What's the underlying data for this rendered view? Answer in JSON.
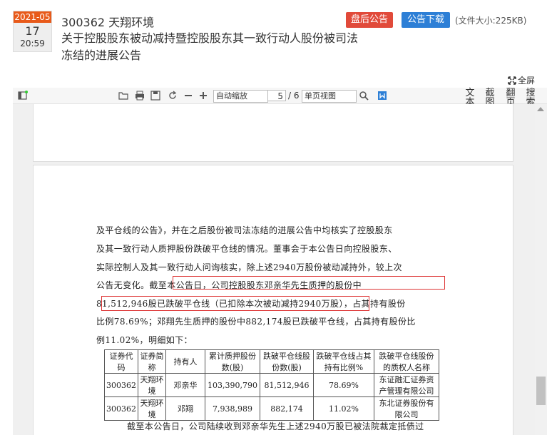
{
  "date": {
    "year_month": "2021-05",
    "day": "17",
    "time": "20:59"
  },
  "header": {
    "code_name": "300362 天翔环境",
    "title": "关于控股股东被动减持暨控股股东其一致行动人股份被司法冻结的进展公告",
    "btn_after": "盘后公告",
    "btn_download": "公告下载",
    "file_size": "(文件大小:225KB)",
    "fullscreen": "全屏"
  },
  "toolbar": {
    "zoom": "自动缩放",
    "page_current": "5",
    "page_total": "/ 6",
    "view_mode": "单页视图",
    "tools": [
      "文本",
      "截图",
      "翻页",
      "搜索"
    ]
  },
  "doc": {
    "lines": [
      "及平仓线的公告》，并在之后股份被司法冻结的进展公告中均核实了控股股东",
      "及其一致行动人质押股份跌破平仓线的情况。董事会于本公告日向控股股东、",
      "实际控制人及其一致行动人问询核实，除上述2940万股份被动减持外，较上次",
      "公告无变化。截至本公告日，公司控股股东邓亲华先生质押的股份中",
      "81,512,946股已跌破平仓线（已扣除本次被动减持2940万股），占其持有股份",
      "比例78.69%；邓翔先生质押的股份中882,174股已跌破平仓线，占其持有股份比",
      "例11.02%，明细如下："
    ],
    "footer_line": "截至本公告日，公司陆续收到邓亲华先生上述2940万股已被法院裁定抵债过",
    "table": {
      "headers": [
        "证券代码",
        "证券简称",
        "持有人",
        "累计质押股份数(股)",
        "跌破平仓线股份数(股)",
        "跌破平仓线占其持有比例%",
        "跌破平仓线股份的质权人名称"
      ],
      "rows": [
        [
          "300362",
          "天翔环境",
          "邓亲华",
          "103,390,790",
          "81,512,946",
          "78.69%",
          "东证融汇证券资产管理有限公司"
        ],
        [
          "300362",
          "天翔环境",
          "邓翔",
          "7,938,989",
          "882,174",
          "11.02%",
          "东北证券股份有限公司"
        ]
      ]
    }
  }
}
